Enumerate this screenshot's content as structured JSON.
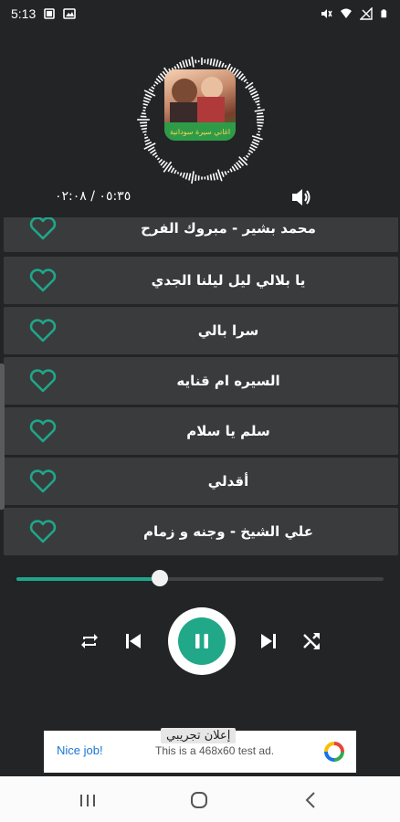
{
  "status_bar": {
    "time": "5:13",
    "left_icons": [
      "gallery-icon",
      "image-icon"
    ],
    "right_icons": [
      "mute-icon",
      "wifi-icon",
      "no-signal-icon",
      "battery-icon"
    ]
  },
  "now_playing": {
    "album_art_text": "اغاني سيرة سودانية",
    "time_readout": "٠٥:٣٥ / ٠٢:٠٨",
    "progress_fraction": 0.39
  },
  "songs": [
    {
      "title": "محمد بشير - مبروك الفرح"
    },
    {
      "title": "يا بلالي ليل ليلنا الجدي"
    },
    {
      "title": "سرا بالي"
    },
    {
      "title": "السيره ام قنايه"
    },
    {
      "title": "سلم يا سلام"
    },
    {
      "title": "أقدلي"
    },
    {
      "title": "علي الشيخ - وجنه و زمام"
    }
  ],
  "controls": {
    "icons": [
      "repeat-icon",
      "previous-icon",
      "pause-icon",
      "next-icon",
      "shuffle-icon"
    ]
  },
  "ad": {
    "label": "إعلان تجريبي",
    "nice_job": "Nice job!",
    "text": "This is a 468x60 test ad."
  },
  "colors": {
    "background": "#232426",
    "row": "#3a3b3d",
    "accent": "#1fa68a",
    "heart": "#1fa68a"
  }
}
